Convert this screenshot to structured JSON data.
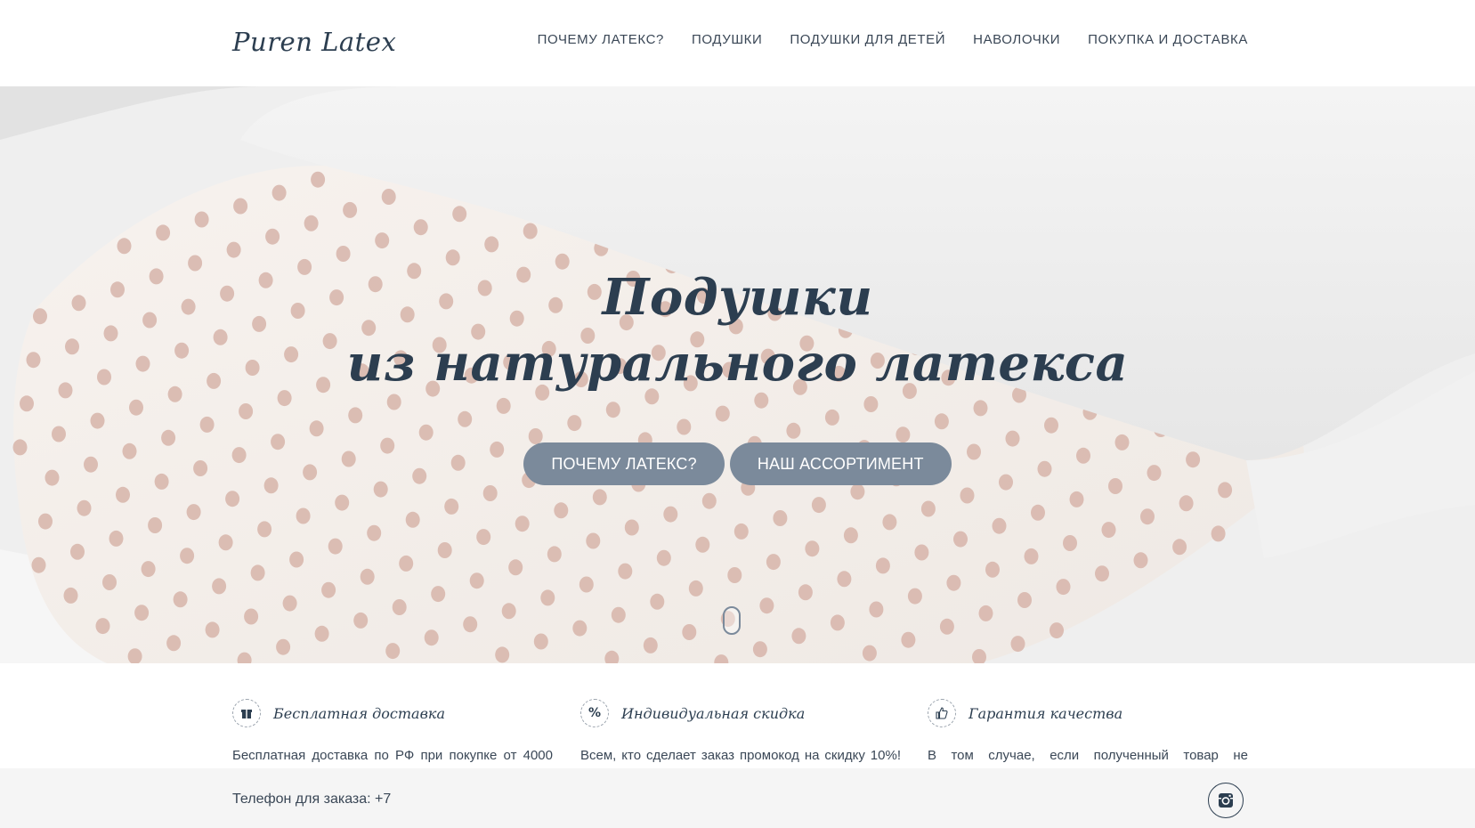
{
  "header": {
    "logo": "Puren Latex",
    "nav": [
      {
        "label": "ПОЧЕМУ ЛАТЕКС?"
      },
      {
        "label": "ПОДУШКИ"
      },
      {
        "label": "ПОДУШКИ ДЛЯ ДЕТЕЙ"
      },
      {
        "label": "НАВОЛОЧКИ"
      },
      {
        "label": "ПОКУПКА И ДОСТАВКА"
      }
    ]
  },
  "hero": {
    "title_line1": "Подушки",
    "title_line2": "из натурального латекса",
    "buttons": {
      "why_latex": "ПОЧЕМУ ЛАТЕКС?",
      "assortment": "НАШ АССОРТИМЕНТ"
    }
  },
  "features": [
    {
      "icon": "gift-icon",
      "title": "Бесплатная доставка",
      "text": "Бесплатная доставка по РФ при покупке от 4000"
    },
    {
      "icon": "percent-icon",
      "title": "Индивидуальная скидка",
      "text": "Всем, кто сделает заказ промокод на скидку 10%!"
    },
    {
      "icon": "thumbs-up-icon",
      "title": "Гарантия качества",
      "text": "В том случае, если полученный товар не"
    }
  ],
  "footer": {
    "phone": "Телефон для заказа: +7",
    "social_icon": "instagram-icon"
  },
  "colors": {
    "text_dark": "#2c3e50",
    "button_bg": "#7b8a9b",
    "latex_hole": "#d9b8ae",
    "footer_bg": "#f5f5f5"
  }
}
